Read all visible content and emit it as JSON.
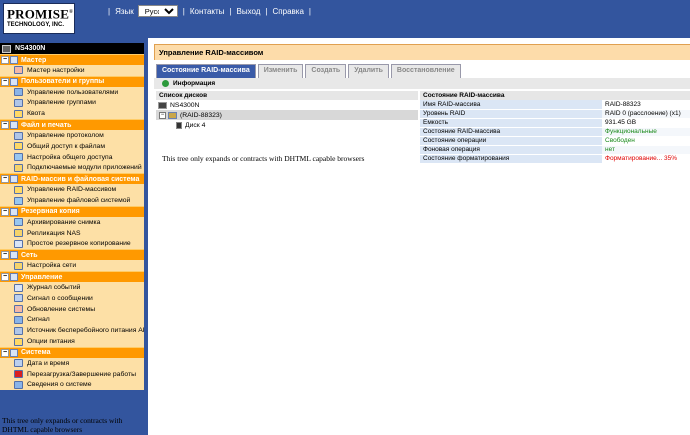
{
  "header": {
    "logo_line1": "PROMISE",
    "logo_reg": "®",
    "logo_line2": "TECHNOLOGY, INC.",
    "language_label": "Язык",
    "language_value": "Русский",
    "nav": [
      "Контакты",
      "Выход",
      "Справка"
    ]
  },
  "sidebar": {
    "root": "NS4300N",
    "groups": [
      {
        "label": "Мастер",
        "items": [
          "Мастер настройки"
        ]
      },
      {
        "label": "Пользователи и группы",
        "items": [
          "Управление пользователями",
          "Управление группами",
          "Квота"
        ]
      },
      {
        "label": "Файл и печать",
        "items": [
          "Управление протоколом",
          "Общий доступ к файлам",
          "Настройка общего доступа",
          "Подключаемые модули приложений"
        ]
      },
      {
        "label": "RAID-массив и файловая система",
        "items": [
          "Управление RAID-массивом",
          "Управление файловой системой"
        ]
      },
      {
        "label": "Резервная копия",
        "items": [
          "Архивирование снимка",
          "Репликация NAS",
          "Простое резервное копирование"
        ]
      },
      {
        "label": "Сеть",
        "items": [
          "Настройка сети"
        ]
      },
      {
        "label": "Управление",
        "items": [
          "Журнал событий",
          "Сигнал о сообщении",
          "Обновление системы",
          "Сигнал",
          "Источник бесперебойного питания APC",
          "Опции питания"
        ]
      },
      {
        "label": "Система",
        "items": [
          "Дата и время",
          "Перезагрузка/Завершение работы",
          "Сведения о системе"
        ]
      }
    ],
    "note": "This tree only expands or contracts with DHTML capable browsers"
  },
  "main": {
    "title": "Управление RAID-массивом",
    "tabs": [
      "Состояние RAID-массива",
      "Изменить",
      "Создать",
      "Удалить",
      "Восстановление"
    ],
    "info_label": "Информация",
    "disk_list": {
      "header": "Список дисков",
      "root": "NS4300N",
      "raid": "(RAID-88323)",
      "disk": "Диск 4",
      "note": "This tree only expands or contracts with DHTML capable browsers"
    },
    "status": {
      "header": "Состояние RAID-массива",
      "rows": [
        {
          "key": "Имя RAID-массива",
          "value": "RAID-88323"
        },
        {
          "key": "Уровень RAID",
          "value": "RAID 0 (расслоение) (x1)"
        },
        {
          "key": "Емкость",
          "value": "931.45 GB"
        },
        {
          "key": "Состояние RAID-массива",
          "value": "Функциональные"
        },
        {
          "key": "Состояние операции",
          "value": "Свободен"
        },
        {
          "key": "Фоновая операция",
          "value": "нет"
        },
        {
          "key": "Состояние форматирования",
          "value": "Форматирование... 35%"
        }
      ]
    }
  },
  "colors": {
    "header_blue": "#33559e",
    "category_orange": "#ff9900",
    "item_bg": "#fde0a6",
    "status_green": "#1a8a1a",
    "status_red": "#e00000"
  }
}
